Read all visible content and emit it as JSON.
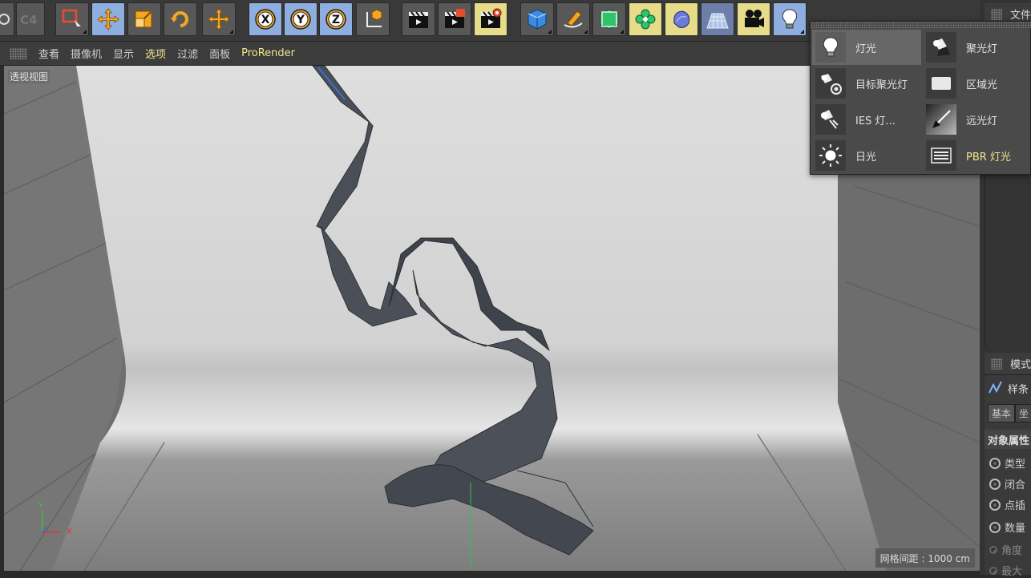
{
  "toolbar": {
    "buttons": [
      {
        "name": "undo-partial-button",
        "icon": "undo-icon"
      },
      {
        "name": "redo-partial-button",
        "icon": "c4d-logo-icon"
      },
      {
        "name": "live-selection-button",
        "icon": "live-selection-icon"
      },
      {
        "name": "move-tool-button",
        "icon": "move-arrows-icon"
      },
      {
        "name": "scale-tool-button",
        "icon": "scale-icon"
      },
      {
        "name": "rotate-tool-button",
        "icon": "rotate-icon"
      },
      {
        "name": "recent-tool-button",
        "icon": "move-arrows-icon"
      },
      {
        "name": "x-axis-lock-button",
        "label": "X"
      },
      {
        "name": "y-axis-lock-button",
        "label": "Y"
      },
      {
        "name": "z-axis-lock-button",
        "label": "Z"
      },
      {
        "name": "coordinate-system-button",
        "icon": "coordinate-system-icon"
      },
      {
        "name": "render-view-button",
        "icon": "clapper-icon"
      },
      {
        "name": "render-picture-viewer-button",
        "icon": "clapper-orange-icon"
      },
      {
        "name": "render-settings-button",
        "icon": "clapper-gear-icon"
      },
      {
        "name": "cube-button",
        "icon": "cube-icon"
      },
      {
        "name": "pen-spline-button",
        "icon": "pen-icon"
      },
      {
        "name": "subdivision-button",
        "icon": "subdivision-cube-icon"
      },
      {
        "name": "cloner-button",
        "icon": "cloner-icon"
      },
      {
        "name": "deformer-button",
        "icon": "deformer-icon"
      },
      {
        "name": "floor-button",
        "icon": "floor-grid-icon"
      },
      {
        "name": "camera-button",
        "icon": "camera-icon"
      },
      {
        "name": "light-button",
        "icon": "light-bulb-icon"
      }
    ]
  },
  "viewport_menu": {
    "items": [
      "查看",
      "摄像机",
      "显示",
      "选项",
      "过滤",
      "面板",
      "ProRender"
    ],
    "active_index": 3
  },
  "viewport": {
    "label": "透视视图",
    "grid_spacing": "网格间距 : 1000 cm",
    "axis_y": "Y",
    "axis_x": "X"
  },
  "right_panel": {
    "top_header": "文件",
    "attr_header": "模式",
    "object_name": "样条",
    "tabs": [
      "基本",
      "坐"
    ],
    "section_title": "对象属性",
    "attributes": [
      "类型",
      "闭合",
      "点插",
      "数量",
      "角度",
      "最大"
    ]
  },
  "light_menu": {
    "items": [
      {
        "label": "灯光",
        "icon": "light-bulb-icon",
        "selected": true
      },
      {
        "label": "聚光灯",
        "icon": "spotlight-icon"
      },
      {
        "label": "目标聚光灯",
        "icon": "target-spotlight-icon"
      },
      {
        "label": "区域光",
        "icon": "area-light-icon"
      },
      {
        "label": "IES 灯...",
        "icon": "ies-light-icon"
      },
      {
        "label": "远光灯",
        "icon": "infinite-light-icon"
      },
      {
        "label": "日光",
        "icon": "sun-icon"
      },
      {
        "label": "PBR 灯光",
        "icon": "pbr-light-icon"
      }
    ]
  },
  "colors": {
    "toolbar_bg": "#393939",
    "active_tool": "#8eaee0",
    "highlight_yellow": "#f0e68c",
    "tool_orange": "#f5a623"
  }
}
